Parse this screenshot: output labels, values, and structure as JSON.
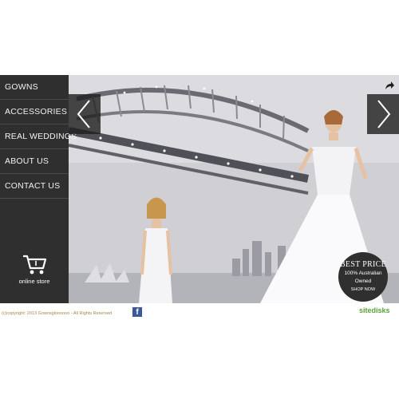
{
  "nav": {
    "items": [
      {
        "label": "GOWNS"
      },
      {
        "label": "ACCESSORIES"
      },
      {
        "label": "REAL WEDDINGS"
      },
      {
        "label": "ABOUT US"
      },
      {
        "label": "CONTACT US"
      }
    ]
  },
  "store": {
    "label": "online store",
    "icon": "shopping-cart-icon"
  },
  "badge": {
    "title": "BEST PRICE",
    "subtitle_line1": "100% Australian",
    "subtitle_line2": "Owned",
    "cta": "SHOP NOW"
  },
  "footer": {
    "copyright": "(c)copyright: 2013 Gownsgloooooo - All Rights Reserved",
    "facebook_icon": "facebook-icon",
    "facebook_glyph": "f",
    "sitedisks_label": "sitedisks"
  },
  "colors": {
    "sidebar": "#2f2f2f",
    "footer_text": "#9a8a4a",
    "sitedisks": "#5aa13a",
    "facebook": "#3b5998"
  }
}
